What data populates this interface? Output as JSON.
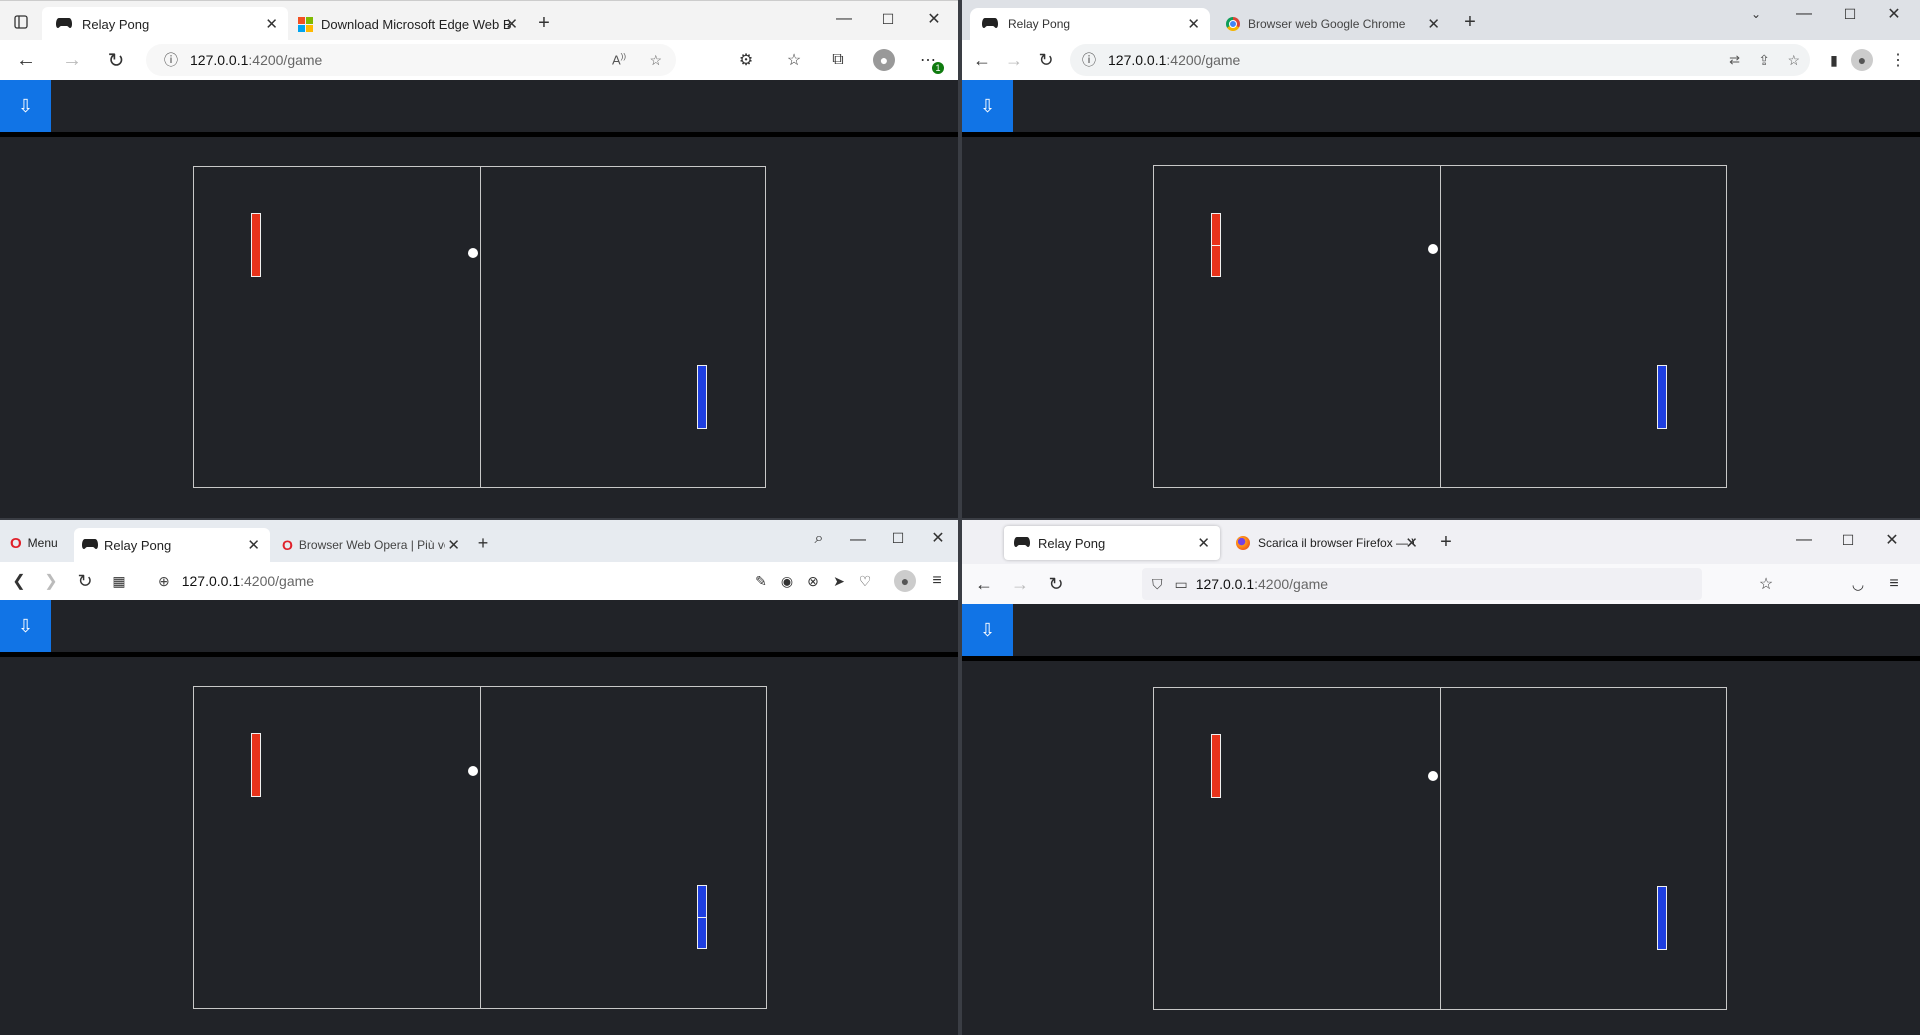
{
  "app": {
    "logo_icon": "⇩",
    "game_title": "Relay Pong"
  },
  "windows": {
    "edge": {
      "tabs": [
        {
          "title": "Relay Pong",
          "icon": "gamepad-icon"
        },
        {
          "title": "Download Microsoft Edge Web B",
          "icon": "microsoft-logo-icon"
        }
      ],
      "url_host": "127.0.0.1",
      "url_path": ":4200/game",
      "badge": "1"
    },
    "chrome": {
      "tabs": [
        {
          "title": "Relay Pong",
          "icon": "gamepad-icon"
        },
        {
          "title": "Browser web Google Chrome",
          "icon": "chrome-logo-icon"
        }
      ],
      "url_host": "127.0.0.1",
      "url_path": ":4200/game"
    },
    "opera": {
      "menu_label": "Menu",
      "tabs": [
        {
          "title": "Relay Pong",
          "icon": "gamepad-icon"
        },
        {
          "title": "Browser Web Opera | Più ve",
          "icon": "opera-logo-icon"
        }
      ],
      "url_host": "127.0.0.1",
      "url_path": ":4200/game"
    },
    "firefox": {
      "tabs": [
        {
          "title": "Relay Pong",
          "icon": "gamepad-icon"
        },
        {
          "title": "Scarica il browser Firefox — Velo",
          "icon": "firefox-logo-icon"
        }
      ],
      "url_host": "127.0.0.1",
      "url_path": ":4200/game"
    }
  },
  "colors": {
    "game_bg": "#212328",
    "accent_blue": "#1174e6",
    "paddle_left": "#e8331b",
    "paddle_right": "#1f3fe0",
    "ball": "#ffffff"
  }
}
